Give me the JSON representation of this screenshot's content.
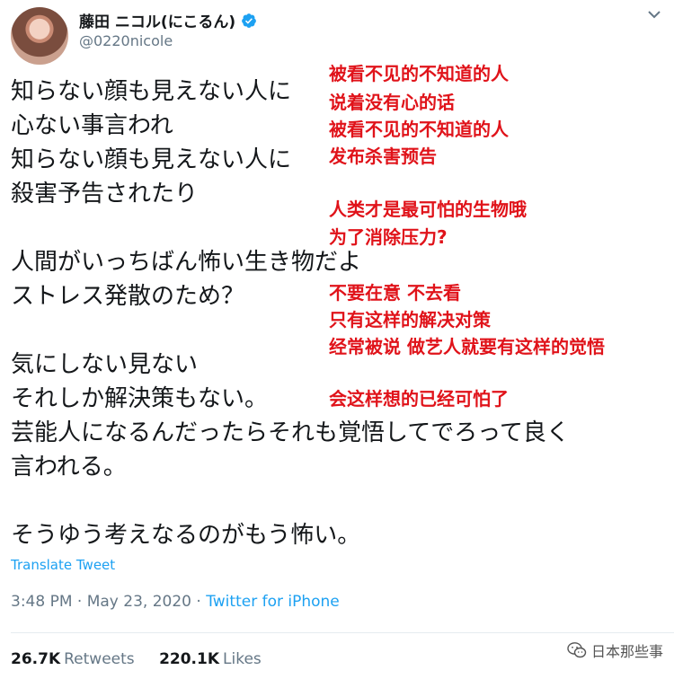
{
  "user": {
    "display_name": "藤田 ニコル(にこるん)",
    "handle": "@0220nicole"
  },
  "tweet": {
    "lines": [
      "知らない顔も見えない人に",
      "心ない事言われ",
      "知らない顔も見えない人に",
      "殺害予告されたり",
      "",
      "人間がいっちばん怖い生き物だよ",
      "ストレス発散のため？",
      "",
      "気にしない見ない",
      "それしか解決策もない。",
      "芸能人になるんだったらそれも覚悟してでろって良く",
      "言われる。",
      "",
      "そうゆう考えなるのがもう怖い。"
    ],
    "translate_label": "Translate Tweet",
    "time": "3:48 PM",
    "date": "May 23, 2020",
    "source": "Twitter for iPhone",
    "separator": "·"
  },
  "stats": {
    "retweets_count": "26.7K",
    "retweets_label": "Retweets",
    "likes_count": "220.1K",
    "likes_label": "Likes"
  },
  "annotations": [
    "被看不见的不知道的人",
    "说着没有心的话",
    "被看不见的不知道的人",
    "发布杀害预告",
    "人类才是最可怕的生物哦",
    "为了消除压力?",
    "不要在意 不去看",
    "只有这样的解决对策",
    "经常被说 做艺人就要有这样的觉悟",
    "会这样想的已经可怕了"
  ],
  "watermark": {
    "text": "日本那些事"
  },
  "colors": {
    "annotation": "#e0131a",
    "link": "#1da1f2",
    "muted": "#657786",
    "verified": "#1da1f2"
  }
}
